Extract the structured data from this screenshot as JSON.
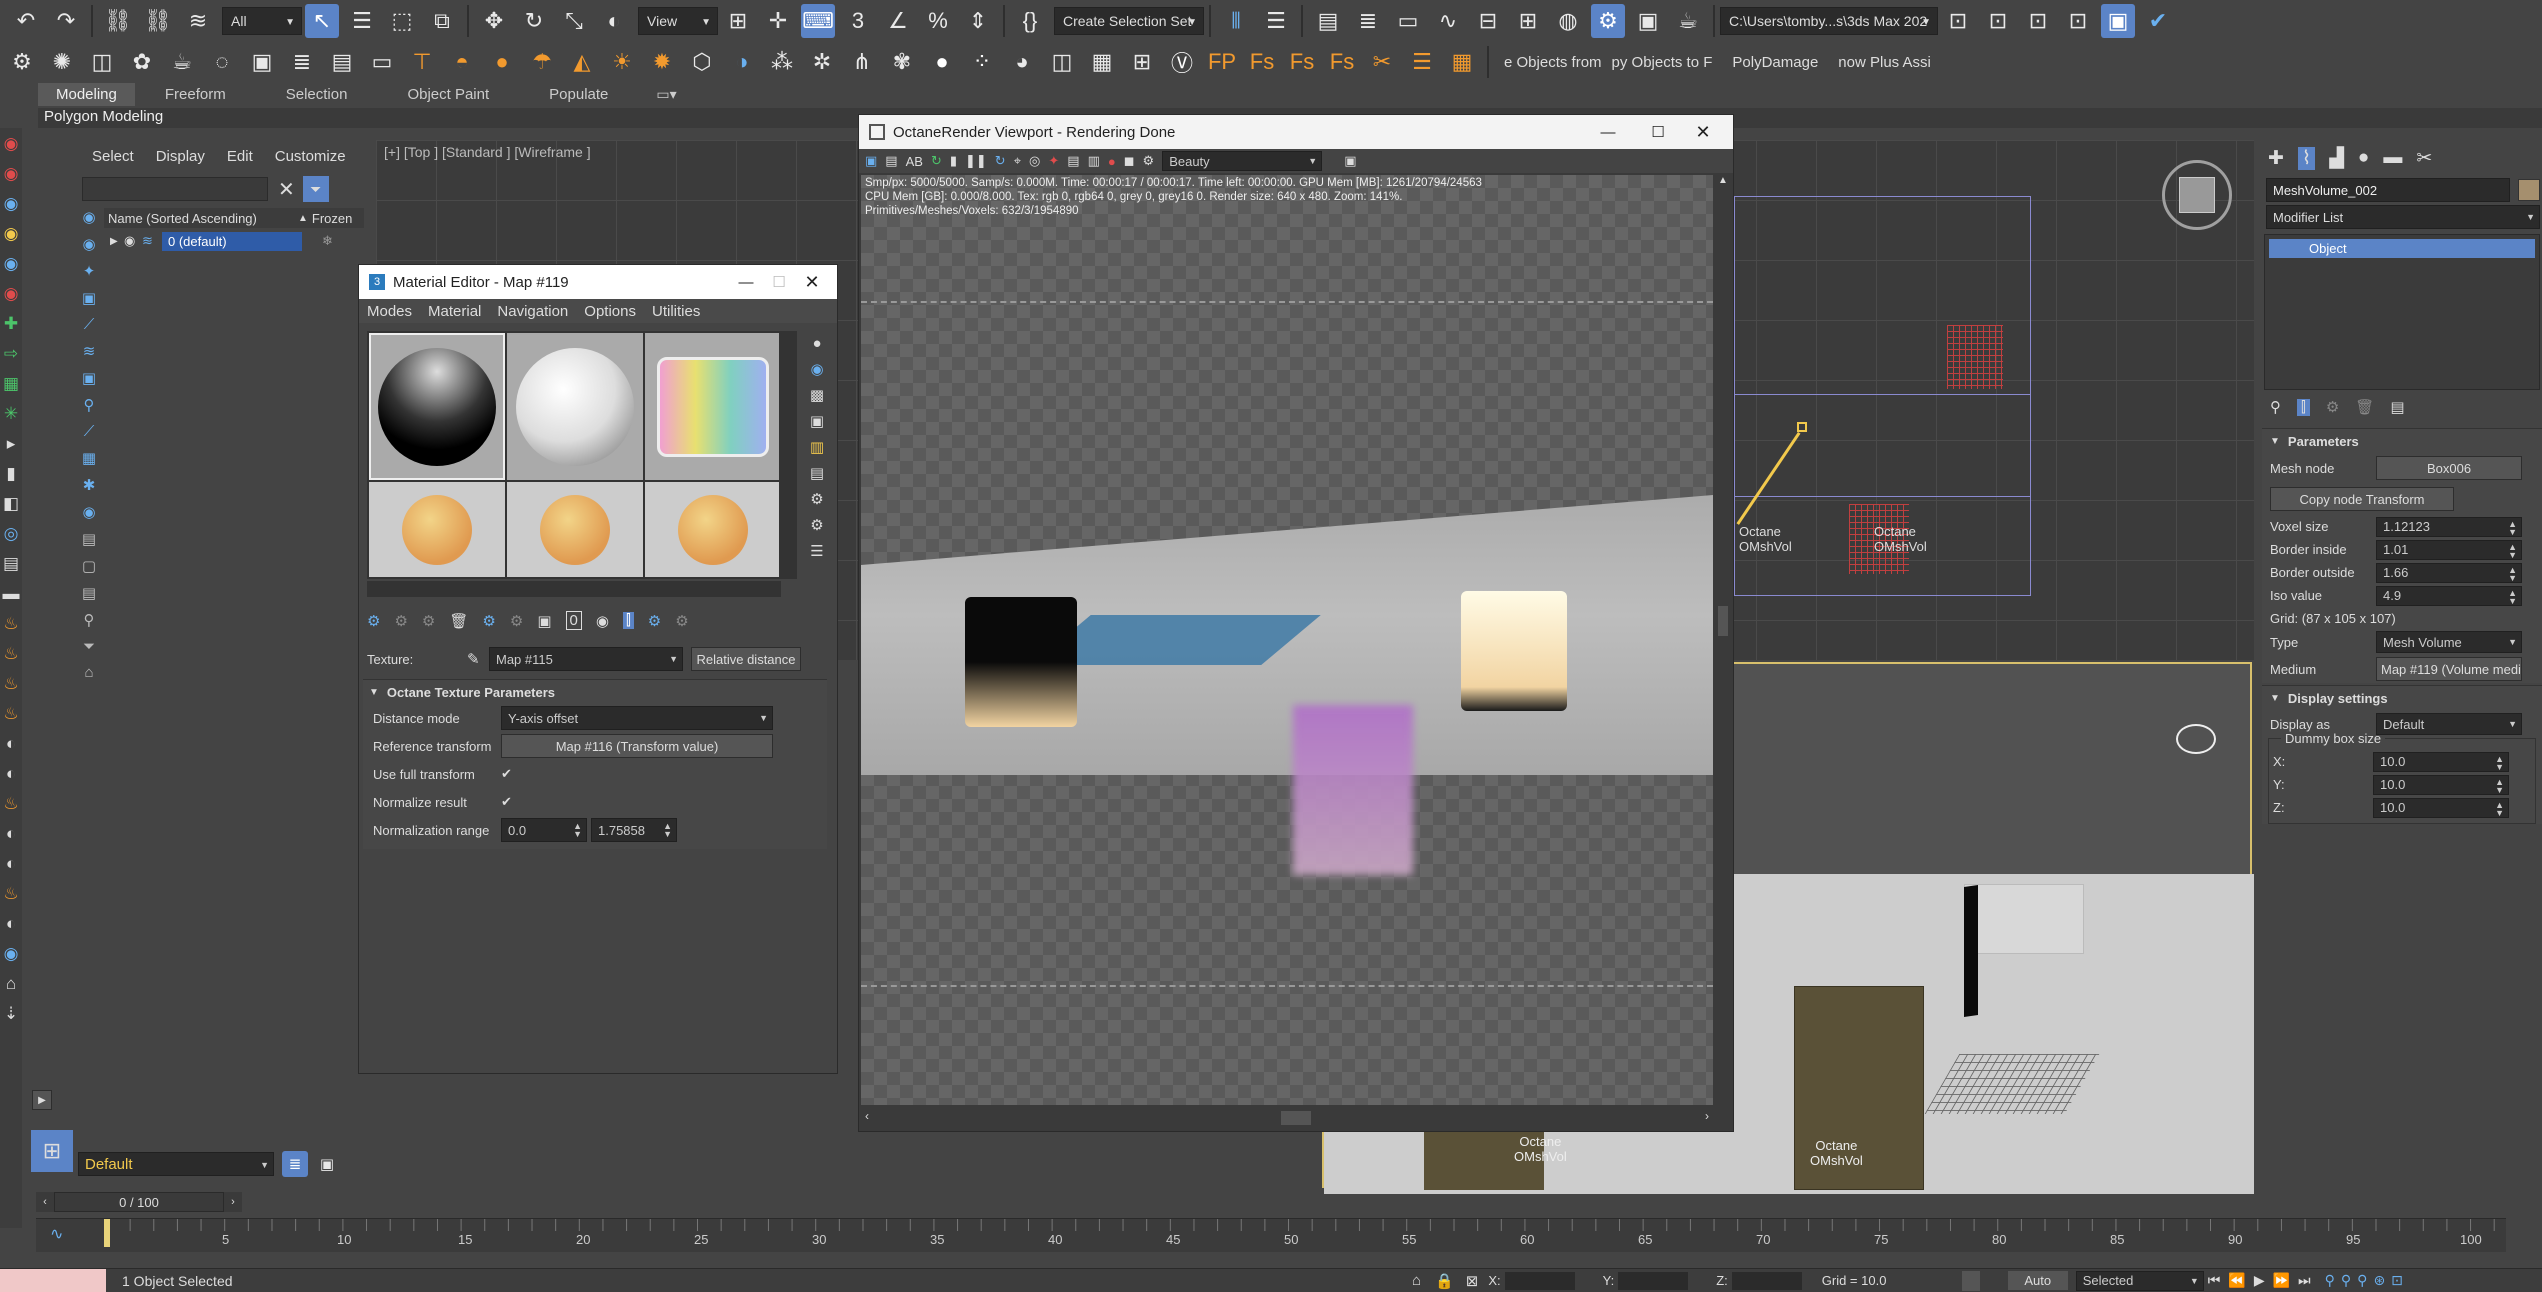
{
  "toolbar1": {
    "filter_value": "All",
    "view_value": "View",
    "selection_set_placeholder": "Create Selection Set",
    "path_value": "C:\\Users\\tomby...s\\3ds Max 202"
  },
  "toolbar2": {
    "tab_labels": [
      "e Objects from",
      "py Objects to F",
      "PolyDamage",
      "now Plus Assi"
    ]
  },
  "ribbon": {
    "tabs": [
      "Modeling",
      "Freeform",
      "Selection",
      "Object Paint",
      "Populate"
    ],
    "polygon_label": "Polygon Modeling"
  },
  "scene_explorer": {
    "menus": [
      "Select",
      "Display",
      "Edit",
      "Customize"
    ],
    "col_name": "Name (Sorted Ascending)",
    "col_frozen": "Frozen",
    "row_label": "0 (default)",
    "layer_value": "Default"
  },
  "viewport_top": {
    "label": "[+] [Top ] [Standard ] [Wireframe ]",
    "obj_label_1": "Octane\nOMshVol",
    "obj_label_2": "Octane\nOMshVol"
  },
  "viewport_persp": {
    "label_1": "Octane\nOMshVol",
    "label_2": "Octane\nOMshVol"
  },
  "material_editor": {
    "title": "Material Editor - Map #119",
    "menus": [
      "Modes",
      "Material",
      "Navigation",
      "Options",
      "Utilities"
    ],
    "texture_label": "Texture:",
    "texture_value": "Map #115",
    "relative_button": "Relative distance",
    "section_title": "Octane Texture Parameters",
    "params": {
      "distance_mode_label": "Distance mode",
      "distance_mode_value": "Y-axis offset",
      "reference_label": "Reference transform",
      "reference_value": "Map #116 (Transform value)",
      "full_transform_label": "Use full transform",
      "normalize_label": "Normalize result",
      "range_label": "Normalization range",
      "range_min": "0.0",
      "range_max": "1.75858"
    }
  },
  "octane": {
    "title": "OctaneRender Viewport - Rendering Done",
    "pass_value": "Beauty",
    "stats_1": "Smp/px: 5000/5000.  Samp/s: 0.000M.  Time: 00:00:17 / 00:00:17.  Time left: 00:00:00.  GPU Mem [MB]: 1261/20794/24563",
    "stats_2": "CPU Mem [GB]: 0.000/8.000.  Tex: rgb 0, rgb64 0, grey 0, grey16 0.  Render size: 640 x 480.  Zoom: 141%.",
    "stats_3": "Primitives/Meshes/Voxels: 632/3/1954890"
  },
  "command_panel": {
    "object_name": "MeshVolume_002",
    "modifier_list": "Modifier List",
    "stack_item": "Object",
    "params_title": "Parameters",
    "mesh_node_label": "Mesh node",
    "mesh_node_value": "Box006",
    "copy_button": "Copy node Transform",
    "voxel_label": "Voxel size",
    "voxel_value": "1.12123",
    "border_in_label": "Border inside",
    "border_in_value": "1.01",
    "border_out_label": "Border outside",
    "border_out_value": "1.66",
    "iso_label": "Iso value",
    "iso_value": "4.9",
    "grid_text": "Grid: (87 x 105 x 107)",
    "type_label": "Type",
    "type_value": "Mesh Volume",
    "medium_label": "Medium",
    "medium_value": "Map #119 (Volume medi",
    "display_title": "Display settings",
    "display_as_label": "Display as",
    "display_as_value": "Default",
    "dummy_label": "Dummy box size",
    "x_label": "X:",
    "x_value": "10.0",
    "y_label": "Y:",
    "y_value": "10.0",
    "z_label": "Z:",
    "z_value": "10.0"
  },
  "timeline": {
    "frame_counter": "0 / 100",
    "ticks": [
      "5",
      "10",
      "15",
      "20",
      "25",
      "30",
      "35",
      "40",
      "45",
      "50",
      "55",
      "60",
      "65",
      "70",
      "75",
      "80",
      "85",
      "90",
      "95",
      "100"
    ]
  },
  "status": {
    "selected_text": "1 Object Selected",
    "x_label": "X:",
    "y_label": "Y:",
    "z_label": "Z:",
    "grid_text": "Grid = 10.0",
    "auto_label": "Auto",
    "selected_dropdown": "Selected"
  }
}
